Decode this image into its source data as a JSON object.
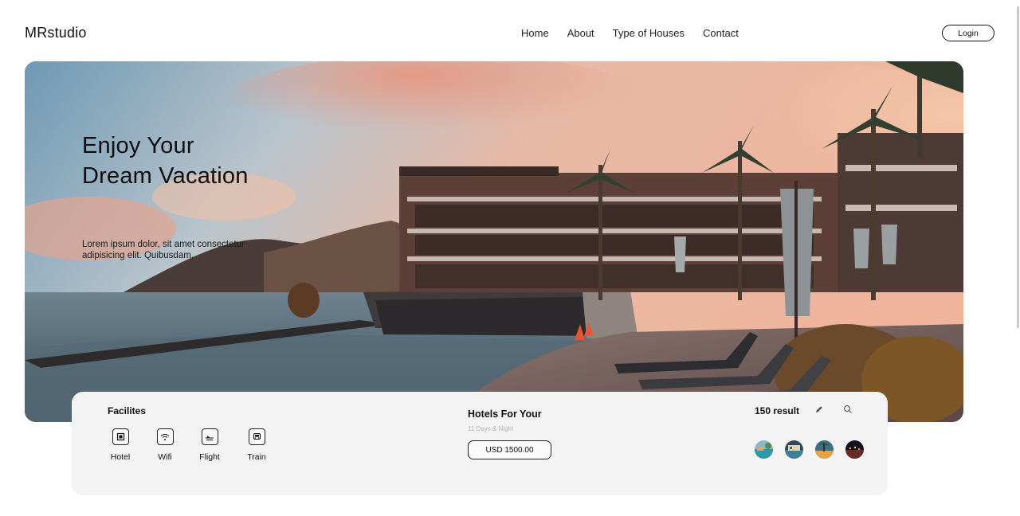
{
  "brand": {
    "logo": "MRstudio"
  },
  "nav": {
    "items": [
      {
        "label": "Home"
      },
      {
        "label": "About"
      },
      {
        "label": "Type of Houses"
      },
      {
        "label": "Contact"
      }
    ],
    "login_label": "Login"
  },
  "hero": {
    "title_line1": "Enjoy Your",
    "title_line2": "Dream Vacation",
    "subtitle": "Lorem ipsum dolor, sit amet consectetur adipisicing elit. Quibusdam."
  },
  "facilities": {
    "title": "Facilites",
    "items": [
      {
        "label": "Hotel",
        "icon": "hotel-icon"
      },
      {
        "label": "Wifi",
        "icon": "wifi-icon"
      },
      {
        "label": "Flight",
        "icon": "flight-icon"
      },
      {
        "label": "Train",
        "icon": "train-icon"
      }
    ]
  },
  "hotels": {
    "title": "Hotels For Your",
    "subtitle": "11 Days & Night",
    "price_label": "USD 1500.00"
  },
  "results": {
    "count_label": "150 result",
    "edit_icon": "pencil-icon",
    "search_icon": "search-icon",
    "thumbnails": [
      "pool-thumbnail",
      "resort-thumbnail",
      "beach-thumbnail",
      "night-thumbnail"
    ]
  },
  "colors": {
    "card_bg": "#f3f3f3",
    "text": "#111111",
    "page_bg": "#ffffff"
  }
}
